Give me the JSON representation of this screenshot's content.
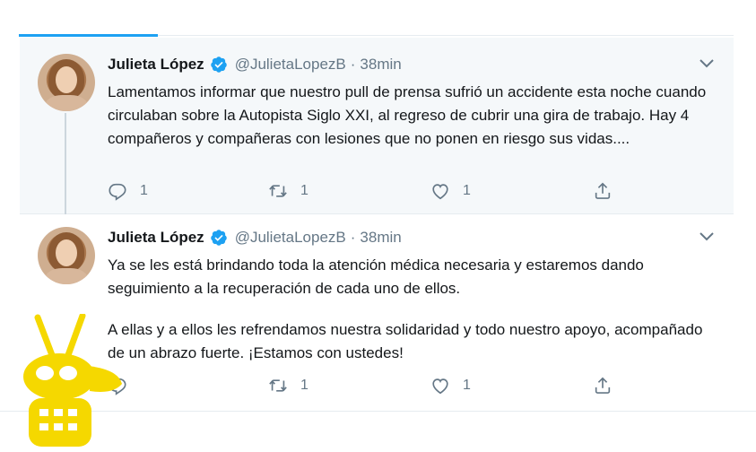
{
  "tweets": [
    {
      "name": "Julieta López",
      "handle": "@JulietaLopezB",
      "dot": "·",
      "time": "38min",
      "paragraphs": [
        "Lamentamos informar que nuestro pull de prensa sufrió un accidente esta noche cuando circulaban sobre la Autopista Siglo XXI, al regreso de cubrir una gira de trabajo. Hay 4 compañeros y compañeras con lesiones que no ponen en riesgo sus vidas...."
      ],
      "replies": "1",
      "retweets": "1",
      "likes": "1"
    },
    {
      "name": "Julieta López",
      "handle": "@JulietaLopezB",
      "dot": "·",
      "time": "38min",
      "paragraphs": [
        "Ya se les está brindando toda la atención médica necesaria y estaremos dando seguimiento a la recuperación de cada uno de ellos.",
        "A ellas y a ellos les refrendamos nuestra solidaridad y todo nuestro apoyo, acompañado de un abrazo fuerte. ¡Estamos con ustedes!"
      ],
      "replies": "",
      "retweets": "1",
      "likes": "1"
    }
  ],
  "colors": {
    "accent": "#1da1f2",
    "text": "#14171a",
    "muted": "#657786",
    "logo": "#f5d800"
  },
  "icons": [
    "verified-badge-icon",
    "chevron-down-icon",
    "reply-icon",
    "retweet-icon",
    "like-icon",
    "share-icon",
    "watermark-logo-icon"
  ]
}
